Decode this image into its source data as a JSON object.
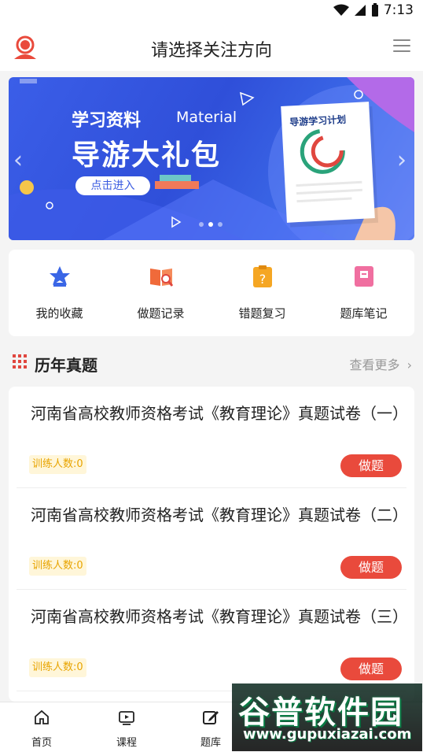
{
  "status_bar": {
    "time": "7:13"
  },
  "header": {
    "title": "请选择关注方向"
  },
  "banner": {
    "line1": "学习资料",
    "line1_en": "Material",
    "line2": "导游大礼包",
    "button": "点击进入",
    "paper_title": "导游学习计划",
    "slide_count": 3,
    "active_slide": 2
  },
  "quick": [
    {
      "label": "我的收藏",
      "icon": "star-badge-icon",
      "color": "#3a66e6"
    },
    {
      "label": "做题记录",
      "icon": "book-search-icon",
      "color": "#f06a3a"
    },
    {
      "label": "错题复习",
      "icon": "question-clipboard-icon",
      "color": "#f5a623"
    },
    {
      "label": "题库笔记",
      "icon": "note-icon",
      "color": "#f06fa0"
    }
  ],
  "section": {
    "title": "历年真题",
    "more": "查看更多"
  },
  "exams": [
    {
      "title": "河南省高校教师资格考试《教育理论》真题试卷（一）",
      "count_label": "训练人数:0",
      "action": "做题"
    },
    {
      "title": "河南省高校教师资格考试《教育理论》真题试卷（二）",
      "count_label": "训练人数:0",
      "action": "做题"
    },
    {
      "title": "河南省高校教师资格考试《教育理论》真题试卷（三）",
      "count_label": "训练人数:0",
      "action": "做题"
    }
  ],
  "tabs": [
    {
      "label": "首页",
      "icon": "home-icon"
    },
    {
      "label": "课程",
      "icon": "video-icon"
    },
    {
      "label": "题库",
      "icon": "edit-icon"
    }
  ],
  "watermark": {
    "line1": "谷普软件园",
    "line2": "www.gupuxiazai.com"
  },
  "colors": {
    "accent": "#e94a3c",
    "banner_blue": "#3b5ee8",
    "badge_text": "#e8a400"
  }
}
